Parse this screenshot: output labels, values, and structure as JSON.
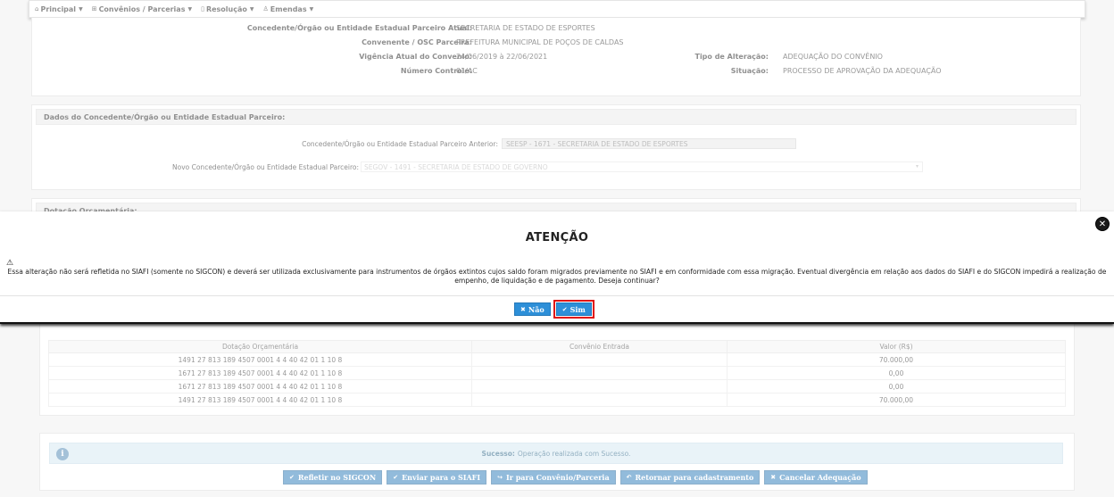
{
  "navbar": {
    "items": [
      {
        "icon": "home-icon",
        "glyph": "⌂",
        "label": "Principal"
      },
      {
        "icon": "grid-icon",
        "glyph": "⊞",
        "label": "Convênios / Parcerias"
      },
      {
        "icon": "document-icon",
        "glyph": "▯",
        "label": "Resolução"
      },
      {
        "icon": "user-icon",
        "glyph": "♙",
        "label": "Emendas"
      }
    ]
  },
  "info": {
    "concedente_label": "Concedente/Órgão ou Entidade Estadual Parceiro Atual:",
    "concedente_value": "SECRETARIA DE ESTADO DE ESPORTES",
    "convenente_label": "Convenente / OSC Parceira:",
    "convenente_value": "PREFEITURA MUNICIPAL DE POÇOS DE CALDAS",
    "vigencia_label": "Vigência Atual do Convenio:",
    "vigencia_value": "24/06/2019 à 22/06/2021",
    "numero_label": "Número Controle:",
    "numero_value": "01/AC",
    "tipo_label": "Tipo de Alteração:",
    "tipo_value": "ADEQUAÇÃO DO CONVÊNIO",
    "situacao_label": "Situação:",
    "situacao_value": "PROCESSO DE APROVAÇÃO DA ADEQUAÇÃO"
  },
  "dados_section": {
    "title": "Dados do Concedente/Órgão ou Entidade Estadual Parceiro:",
    "anterior_label": "Concedente/Órgão ou Entidade Estadual Parceiro Anterior:",
    "anterior_value": "SEESP - 1671 - SECRETARIA DE ESTADO DE ESPORTES",
    "novo_label": "Novo Concedente/Órgão ou Entidade Estadual Parceiro:",
    "novo_value": "SEGOV - 1491 - SECRETARIA DE ESTADO DE GOVERNO"
  },
  "dotacao_section": {
    "title": "Dotação Orçamentária:"
  },
  "table": {
    "headers": [
      "Dotação Orçamentária",
      "Convênio Entrada",
      "Valor (R$)"
    ],
    "rows": [
      [
        "1491 27 813 189 4507 0001 4 4 40 42 01 1 10 8",
        "",
        "70.000,00"
      ],
      [
        "1671 27 813 189 4507 0001 4 4 40 42 01 1 10 8",
        "",
        "0,00"
      ],
      [
        "1671 27 813 189 4507 0001 4 4 40 42 01 1 10 8",
        "",
        "0,00"
      ],
      [
        "1491 27 813 189 4507 0001 4 4 40 42 01 1 10 8",
        "",
        "70.000,00"
      ]
    ]
  },
  "alert": {
    "icon": "info-icon",
    "title": "Sucesso:",
    "message": "Operação realizada com Sucesso."
  },
  "actions": [
    {
      "name": "refletir-sigcon-button",
      "icon": "check-icon",
      "glyph": "✔",
      "label": "Refletir no SIGCON"
    },
    {
      "name": "enviar-siafi-button",
      "icon": "check-icon",
      "glyph": "✔",
      "label": "Enviar para o SIAFI"
    },
    {
      "name": "ir-convenio-button",
      "icon": "arrow-icon",
      "glyph": "↪",
      "label": "Ir para Convênio/Parceria"
    },
    {
      "name": "retornar-button",
      "icon": "undo-icon",
      "glyph": "↶",
      "label": "Retornar para cadastramento"
    },
    {
      "name": "cancelar-adequacao-button",
      "icon": "close-icon",
      "glyph": "✖",
      "label": "Cancelar Adequação"
    }
  ],
  "modal": {
    "title": "ATENÇÃO",
    "close_icon": "close-circle-icon",
    "warning_icon": "warning-icon",
    "message": "Essa alteração não será refletida no SIAFI (somente no SIGCON) e deverá ser utilizada exclusivamente para instrumentos de órgãos extintos cujos saldo foram migrados previamente no SIAFI e em conformidade com essa migração. Eventual divergência em relação aos dados do SIAFI e do SIGCON impedirá a realização de empenho, de liquidação e de pagamento. Deseja continuar?",
    "no_label": "Não",
    "yes_label": "Sim",
    "highlight_color": "#e01010",
    "button_color": "#2d8fd8"
  }
}
